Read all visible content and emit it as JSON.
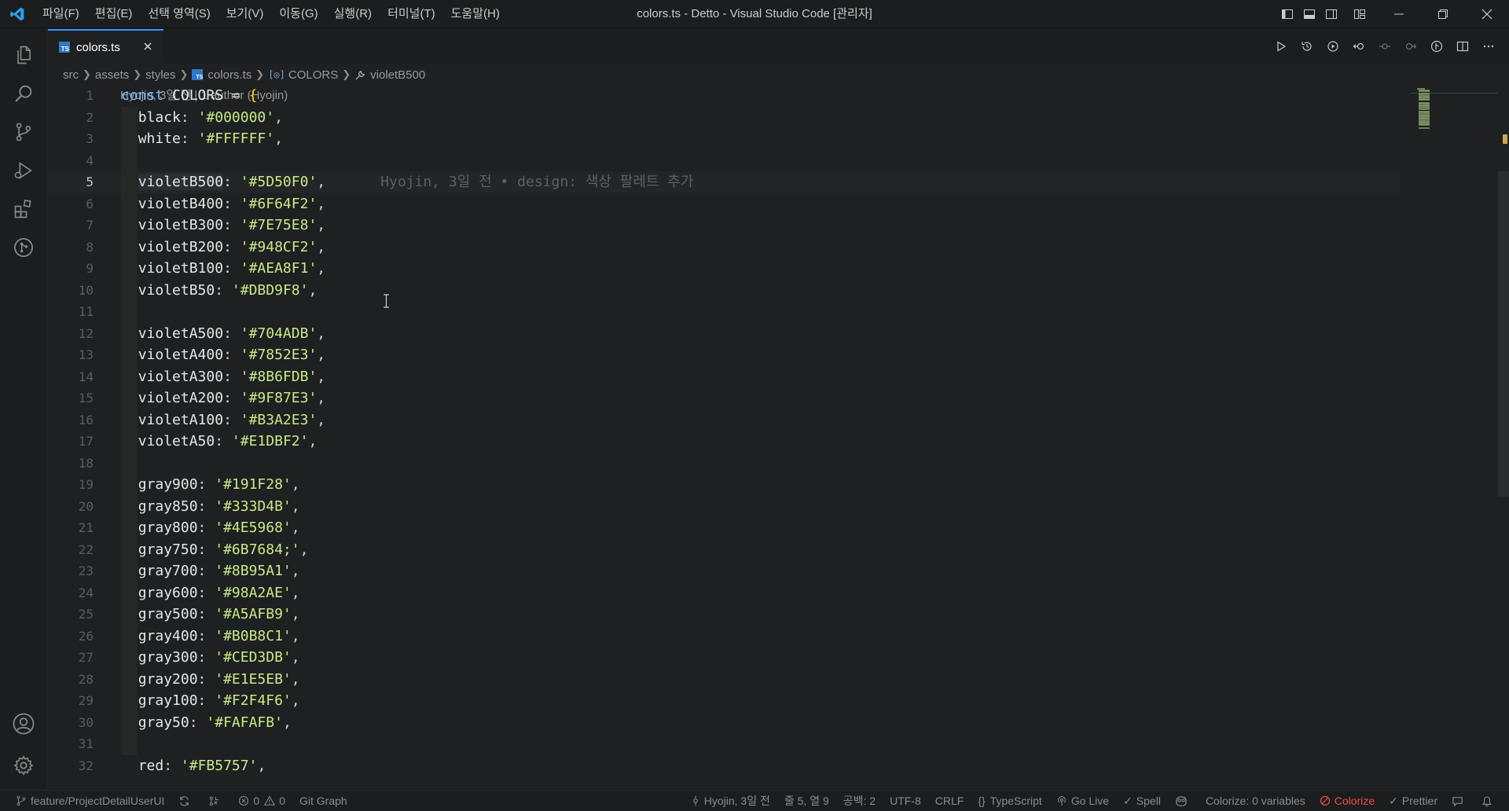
{
  "window": {
    "title": "colors.ts - Detto - Visual Studio Code [관리자]"
  },
  "menu": [
    "파일(F)",
    "편집(E)",
    "선택 영역(S)",
    "보기(V)",
    "이동(G)",
    "실행(R)",
    "터미널(T)",
    "도움말(H)"
  ],
  "tab": {
    "badge": "TS",
    "label": "colors.ts"
  },
  "breadcrumb": {
    "items": [
      "src",
      "assets",
      "styles",
      "colors.ts",
      "COLORS",
      "violetB500"
    ]
  },
  "codelens": "Hyojin, 3일 전 | 1 author (Hyojin)",
  "blame": "Hyojin, 3일 전 • design: 색상 팔레트 추가",
  "code": {
    "lines": [
      {
        "n": "1",
        "key": "const COLORS",
        "val": ""
      },
      {
        "n": "2",
        "key": "black",
        "val": "'#000000'"
      },
      {
        "n": "3",
        "key": "white",
        "val": "'#FFFFFF'"
      },
      {
        "n": "4",
        "key": "",
        "val": ""
      },
      {
        "n": "5",
        "key": "violetB500",
        "val": "'#5D50F0'"
      },
      {
        "n": "6",
        "key": "violetB400",
        "val": "'#6F64F2'"
      },
      {
        "n": "7",
        "key": "violetB300",
        "val": "'#7E75E8'"
      },
      {
        "n": "8",
        "key": "violetB200",
        "val": "'#948CF2'"
      },
      {
        "n": "9",
        "key": "violetB100",
        "val": "'#AEA8F1'"
      },
      {
        "n": "10",
        "key": "violetB50",
        "val": "'#DBD9F8'"
      },
      {
        "n": "11",
        "key": "",
        "val": ""
      },
      {
        "n": "12",
        "key": "violetA500",
        "val": "'#704ADB'"
      },
      {
        "n": "13",
        "key": "violetA400",
        "val": "'#7852E3'"
      },
      {
        "n": "14",
        "key": "violetA300",
        "val": "'#8B6FDB'"
      },
      {
        "n": "15",
        "key": "violetA200",
        "val": "'#9F87E3'"
      },
      {
        "n": "16",
        "key": "violetA100",
        "val": "'#B3A2E3'"
      },
      {
        "n": "17",
        "key": "violetA50",
        "val": "'#E1DBF2'"
      },
      {
        "n": "18",
        "key": "",
        "val": ""
      },
      {
        "n": "19",
        "key": "gray900",
        "val": "'#191F28'"
      },
      {
        "n": "20",
        "key": "gray850",
        "val": "'#333D4B'"
      },
      {
        "n": "21",
        "key": "gray800",
        "val": "'#4E5968'"
      },
      {
        "n": "22",
        "key": "gray750",
        "val": "'#6B7684;'"
      },
      {
        "n": "23",
        "key": "gray700",
        "val": "'#8B95A1'"
      },
      {
        "n": "24",
        "key": "gray600",
        "val": "'#98A2AE'"
      },
      {
        "n": "25",
        "key": "gray500",
        "val": "'#A5AFB9'"
      },
      {
        "n": "26",
        "key": "gray400",
        "val": "'#B0B8C1'"
      },
      {
        "n": "27",
        "key": "gray300",
        "val": "'#CED3DB'"
      },
      {
        "n": "28",
        "key": "gray200",
        "val": "'#E1E5EB'"
      },
      {
        "n": "29",
        "key": "gray100",
        "val": "'#F2F4F6'"
      },
      {
        "n": "30",
        "key": "gray50",
        "val": "'#FAFAFB'"
      },
      {
        "n": "31",
        "key": "",
        "val": ""
      },
      {
        "n": "32",
        "key": "red",
        "val": "'#FB5757'"
      }
    ]
  },
  "status": {
    "branch": "feature/ProjectDetailUserUI",
    "errors": "0",
    "warnings": "0",
    "git_graph": "Git Graph",
    "blame": "Hyojin, 3일 전",
    "position": "줄 5, 열 9",
    "spaces": "공백: 2",
    "encoding": "UTF-8",
    "eol": "CRLF",
    "language": "TypeScript",
    "go_live": "Go Live",
    "spell": "Spell",
    "colorize_vars": "Colorize: 0 variables",
    "colorize": "Colorize",
    "prettier": "Prettier"
  },
  "icons": {
    "activity": [
      "files-icon",
      "search-icon",
      "source-control-icon",
      "run-debug-icon",
      "extensions-icon",
      "git-graph-icon",
      "account-icon",
      "settings-gear-icon"
    ]
  },
  "colors": {
    "accent": "#3794ff",
    "string": "#c8ea88",
    "keyword": "#7fb4ff",
    "error": "#f14c4c"
  }
}
